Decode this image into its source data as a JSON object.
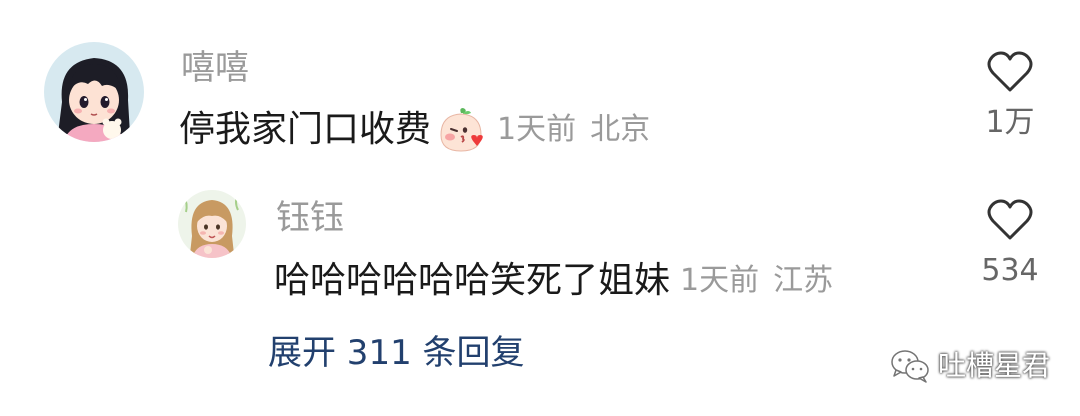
{
  "comment": {
    "username": "嘻嘻",
    "text": "停我家门口收费",
    "emoji_icon": "blush-kiss-peach-emoji",
    "time": "1天前",
    "location": "北京",
    "like_icon": "heart-outline-icon",
    "like_count": "1万",
    "avatar_icon": "anime-girl-avatar"
  },
  "reply": {
    "username": "钰钰",
    "text": "哈哈哈哈哈哈笑死了姐妹",
    "time": "1天前",
    "location": "江苏",
    "like_icon": "heart-outline-icon",
    "like_count": "534",
    "avatar_icon": "illustrated-girl-avatar"
  },
  "expand": {
    "label": "展开 311 条回复"
  },
  "watermark": {
    "icon": "wechat-logo-icon",
    "text": "吐槽星君"
  },
  "colors": {
    "username": "#9a9a9a",
    "text": "#1a1a1a",
    "link": "#22406e",
    "meta": "#9a9a9a"
  }
}
